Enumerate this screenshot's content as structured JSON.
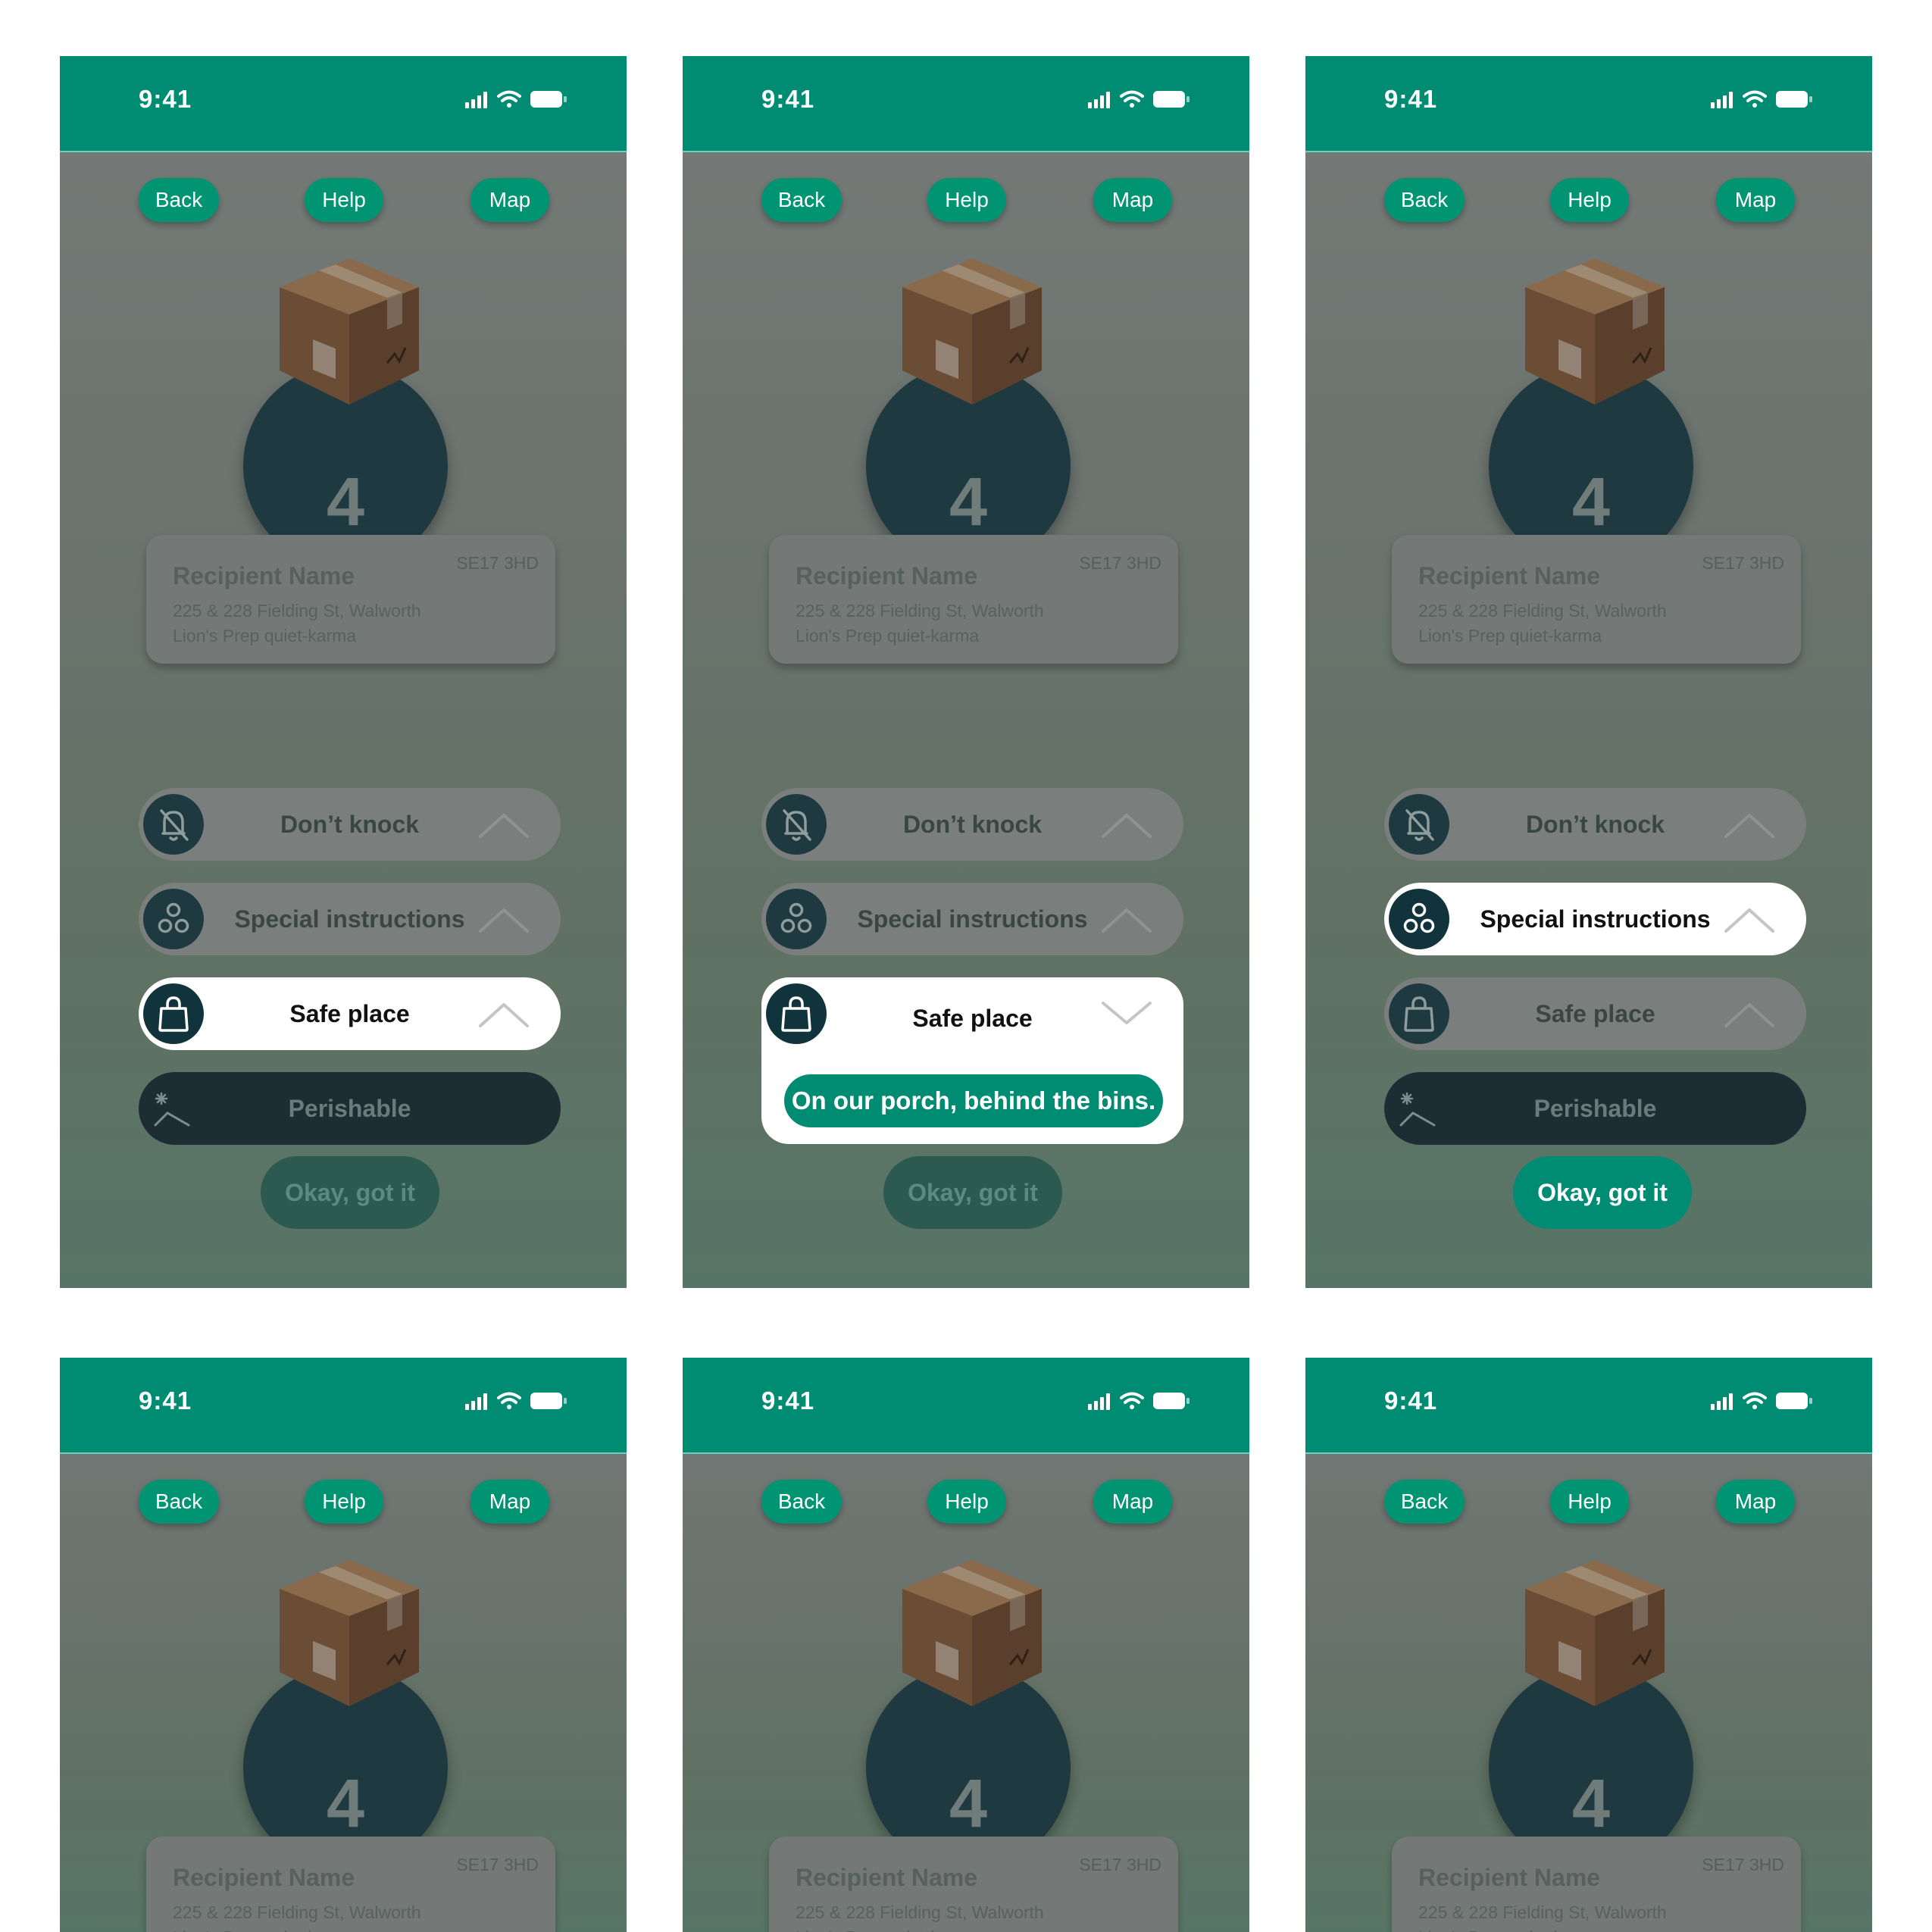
{
  "status_bar": {
    "time": "9:41"
  },
  "nav": {
    "back": "Back",
    "help": "Help",
    "map": "Map"
  },
  "stop": {
    "number": "4"
  },
  "recipient": {
    "name": "Recipient Name",
    "postcode": "SE17 3HD",
    "address_line1": "225 & 228 Fielding St, Walworth",
    "address_line2": "Lion's Prep quiet-karma"
  },
  "options": {
    "dont_knock": "Don’t knock",
    "special_instructions": "Special instructions",
    "safe_place": "Safe place",
    "perishable": "Perishable"
  },
  "safe_place_note": "On our porch, behind the bins.",
  "confirm_button": "Okay, got it",
  "colors": {
    "brand_green": "#008c72",
    "dark_navy": "#1e3a40",
    "overlay_gray": "#6f7572"
  },
  "icons": [
    "cellular-signal-icon",
    "wifi-icon",
    "battery-icon",
    "package-box-icon",
    "bell-off-icon",
    "three-circles-icon",
    "shopping-bag-icon",
    "perishable-icon",
    "chevron-up-icon",
    "chevron-down-icon"
  ]
}
